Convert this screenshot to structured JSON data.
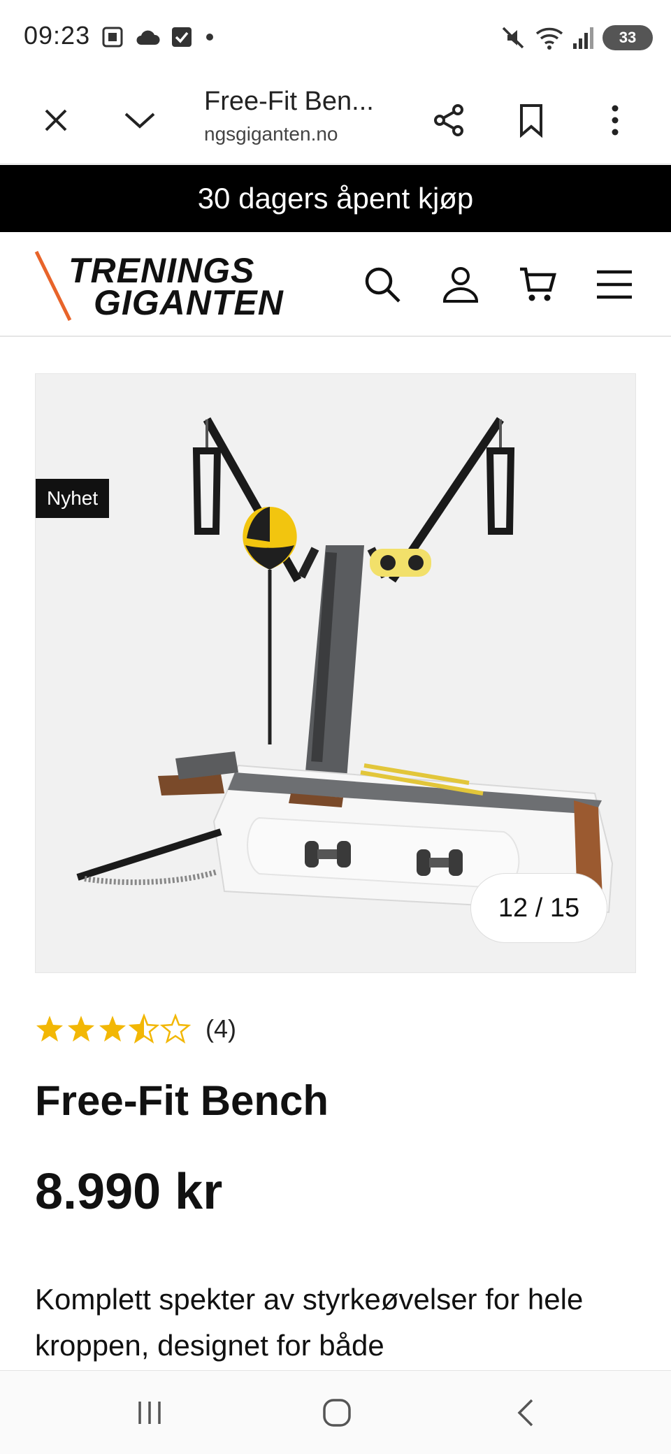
{
  "status_bar": {
    "time": "09:23",
    "battery": "33"
  },
  "browser": {
    "tab_title": "Free-Fit Ben...",
    "url": "ngsgiganten.no"
  },
  "promo": {
    "text": "30 dagers åpent kjøp"
  },
  "site": {
    "logo_line1": "TRENINGS",
    "logo_line2": "GIGANTEN",
    "accent_color": "#e8642a"
  },
  "product": {
    "badge": "Nyhet",
    "image_counter": "12 / 15",
    "rating": 3.5,
    "rating_max": 5,
    "rating_count": "(4)",
    "title": "Free-Fit Bench",
    "price": "8.990 kr",
    "description": "Komplett spekter av styrkeøvelser for hele kroppen, designet for både",
    "star_color": "#f2b705"
  }
}
